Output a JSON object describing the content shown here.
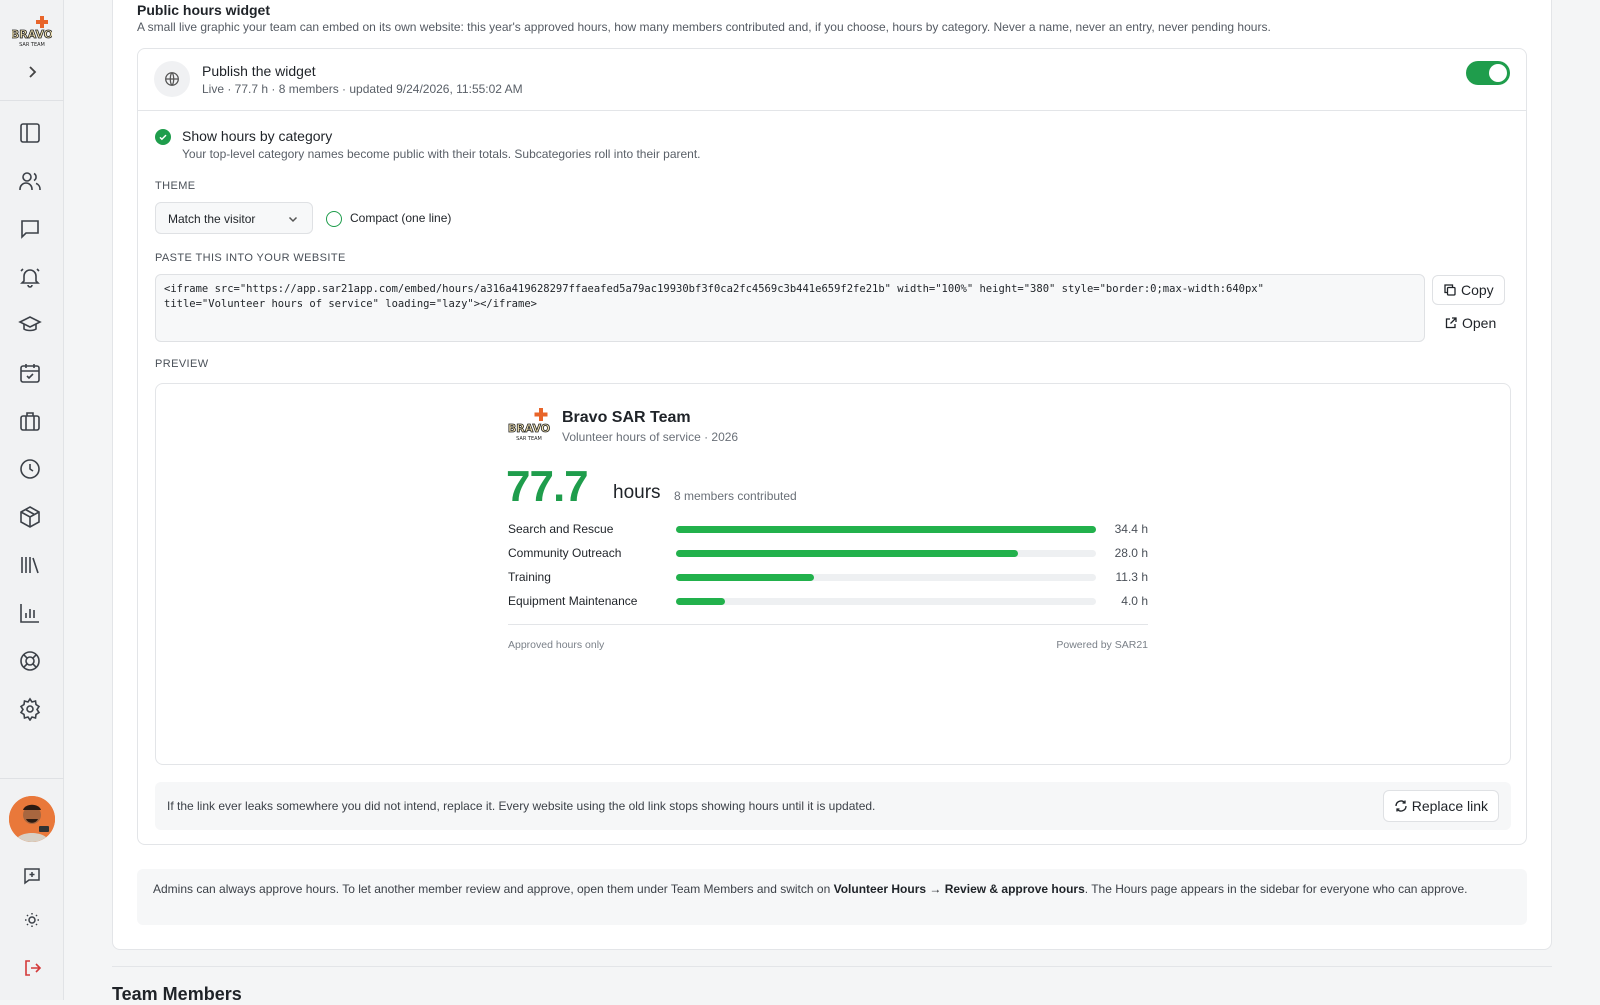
{
  "app": {
    "logo_text": "BRAVO",
    "logo_subtext": "SAR TEAM"
  },
  "sidebar": {
    "items": [
      {
        "icon": "panel-icon"
      },
      {
        "icon": "users-icon"
      },
      {
        "icon": "message-icon"
      },
      {
        "icon": "bell-icon"
      },
      {
        "icon": "graduation-icon"
      },
      {
        "icon": "calendar-check-icon"
      },
      {
        "icon": "briefcase-icon"
      },
      {
        "icon": "clock-icon"
      },
      {
        "icon": "package-icon"
      },
      {
        "icon": "library-icon"
      },
      {
        "icon": "bar-chart-icon"
      },
      {
        "icon": "lifebuoy-icon"
      },
      {
        "icon": "gear-icon"
      }
    ]
  },
  "widget": {
    "title": "Public hours widget",
    "description": "A small live graphic your team can embed on its own website: this year's approved hours, how many members contributed and, if you choose, hours by category. Never a name, never an entry, never pending hours.",
    "publish_title": "Publish the widget",
    "publish_status": "Live · 77.7 h · 8 members · updated 9/24/2026, 11:55:02 AM",
    "publish_enabled": true,
    "show_category_label": "Show hours by category",
    "show_category_desc": "Your top-level category names become public with their totals. Subcategories roll into their parent.",
    "show_category_checked": true,
    "theme_label": "THEME",
    "theme_value": "Match the visitor",
    "compact_label": "Compact (one line)",
    "compact_checked": false,
    "embed_label": "PASTE THIS INTO YOUR WEBSITE",
    "embed_code": "<iframe src=\"https://app.sar21app.com/embed/hours/a316a419628297ffaeafed5a79ac19930bf3f0ca2fc4569c3b441e659f2fe21b\" width=\"100%\" height=\"380\" style=\"border:0;max-width:640px\"\ntitle=\"Volunteer hours of service\" loading=\"lazy\"></iframe>",
    "copy_label": "Copy",
    "open_label": "Open",
    "preview_label": "PREVIEW",
    "leak_text": "If the link ever leaks somewhere you did not intend, replace it. Every website using the old link stops showing hours until it is updated.",
    "replace_label": "Replace link"
  },
  "preview": {
    "team_name": "Bravo SAR Team",
    "subtitle": "Volunteer hours of service · 2026",
    "total": "77.7",
    "unit": "hours",
    "members": "8 members contributed",
    "footer_left": "Approved hours only",
    "footer_right": "Powered by SAR21",
    "categories": [
      {
        "name": "Search and Rescue",
        "hours": 34.4,
        "label": "34.4 h"
      },
      {
        "name": "Community Outreach",
        "hours": 28.0,
        "label": "28.0 h"
      },
      {
        "name": "Training",
        "hours": 11.3,
        "label": "11.3 h"
      },
      {
        "name": "Equipment Maintenance",
        "hours": 4.0,
        "label": "4.0 h"
      }
    ]
  },
  "note": {
    "part1": "Admins can always approve hours. To let another member review and approve, open them under Team Members and switch on ",
    "bold": "Volunteer Hours → Review & approve hours",
    "part2": ". The Hours page appears in the sidebar for everyone who can approve."
  },
  "next_section_title": "Team Members",
  "colors": {
    "accent": "#1f9d4c",
    "bar": "#22b14c"
  }
}
